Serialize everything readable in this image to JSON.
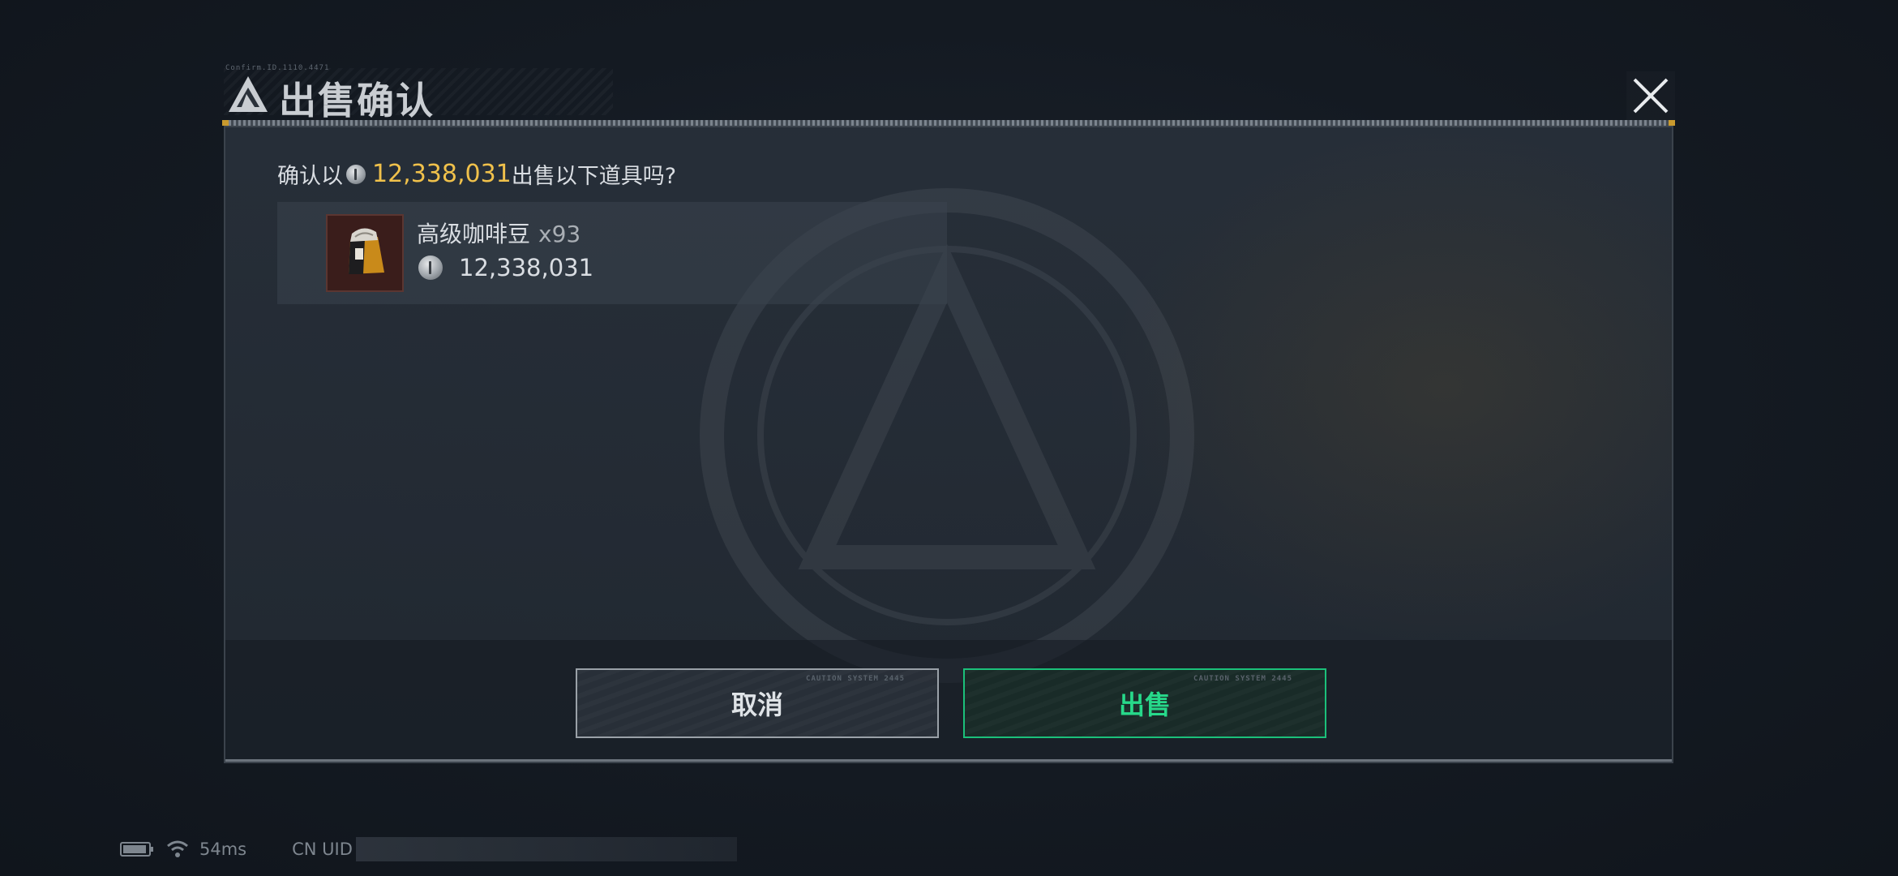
{
  "dialog": {
    "title": "出售确认",
    "title_micro": "Confirm.ID.1110.4471",
    "question_prefix": "确认以",
    "question_price": "12,338,031",
    "question_suffix": "出售以下道具吗?",
    "item": {
      "name": "高级咖啡豆",
      "quantity": "x93",
      "price": "12,338,031"
    },
    "buttons": {
      "cancel": "取消",
      "sell": "出售",
      "cancel_micro": "CAUTION  SYSTEM  2445",
      "sell_micro": "CAUTION  SYSTEM  2445"
    }
  },
  "status_bar": {
    "latency": "54ms",
    "uid_label": "CN UID"
  },
  "icons": {
    "logo": "delta-logo-icon",
    "close": "close-icon",
    "coin": "coin-icon",
    "item": "coffee-bean-bag-icon",
    "battery": "battery-icon",
    "wifi": "wifi-icon"
  },
  "colors": {
    "price_highlight": "#f0c14b",
    "sell_accent": "#1bc07a",
    "item_background": "#3a1d1b"
  }
}
